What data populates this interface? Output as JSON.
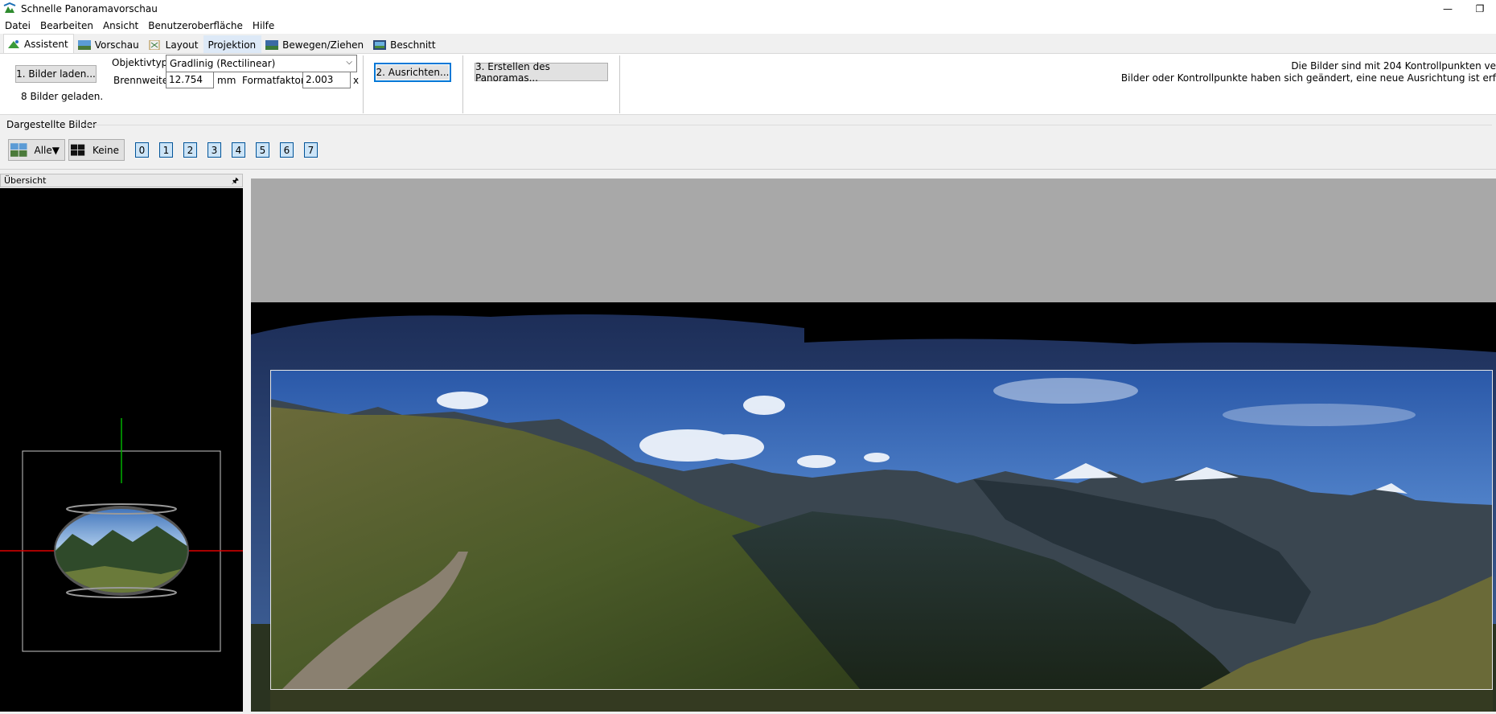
{
  "window": {
    "title": "Schnelle Panoramavorschau",
    "minimize_glyph": "—",
    "restore_glyph": "❐"
  },
  "menu": [
    "Datei",
    "Bearbeiten",
    "Ansicht",
    "Benutzeroberfläche",
    "Hilfe"
  ],
  "tabs": [
    {
      "label": "Assistent",
      "icon": "wizard-icon"
    },
    {
      "label": "Vorschau",
      "icon": "preview-icon"
    },
    {
      "label": "Layout",
      "icon": "layout-icon"
    },
    {
      "label": "Projektion",
      "icon": "projection-icon"
    },
    {
      "label": "Bewegen/Ziehen",
      "icon": "move-drag-icon"
    },
    {
      "label": "Beschnitt",
      "icon": "crop-icon"
    }
  ],
  "assistant": {
    "load_button": "1. Bilder laden...",
    "loaded_status": "8 Bilder geladen.",
    "lens_type_label": "Objektivtyp:",
    "lens_type_value": "Gradlinig (Rectilinear)",
    "focal_length_label": "Brennweite:",
    "focal_length_value": "12.754",
    "focal_length_unit": "mm",
    "crop_factor_label": "Formatfaktor:",
    "crop_factor_value": "2.003",
    "crop_factor_unit": "x",
    "align_button": "2. Ausrichten...",
    "create_button": "3. Erstellen des Panoramas...",
    "status_line1": "Die Bilder sind mit 204 Kontrollpunkten ve",
    "status_line2": "Bilder oder Kontrollpunkte haben sich geändert, eine neue Ausrichtung ist erf"
  },
  "displayed_images": {
    "title": "Dargestellte Bilder",
    "all_label": "Alle▼",
    "none_label": "Keine",
    "numbers": [
      "0",
      "1",
      "2",
      "3",
      "4",
      "5",
      "6",
      "7"
    ]
  },
  "overview": {
    "title": "Übersicht",
    "pin_glyph": "🖈"
  },
  "colors": {
    "accent": "#0078d7",
    "overview_bg": "#000000",
    "axis_red": "#e00000",
    "axis_green": "#00b000"
  }
}
